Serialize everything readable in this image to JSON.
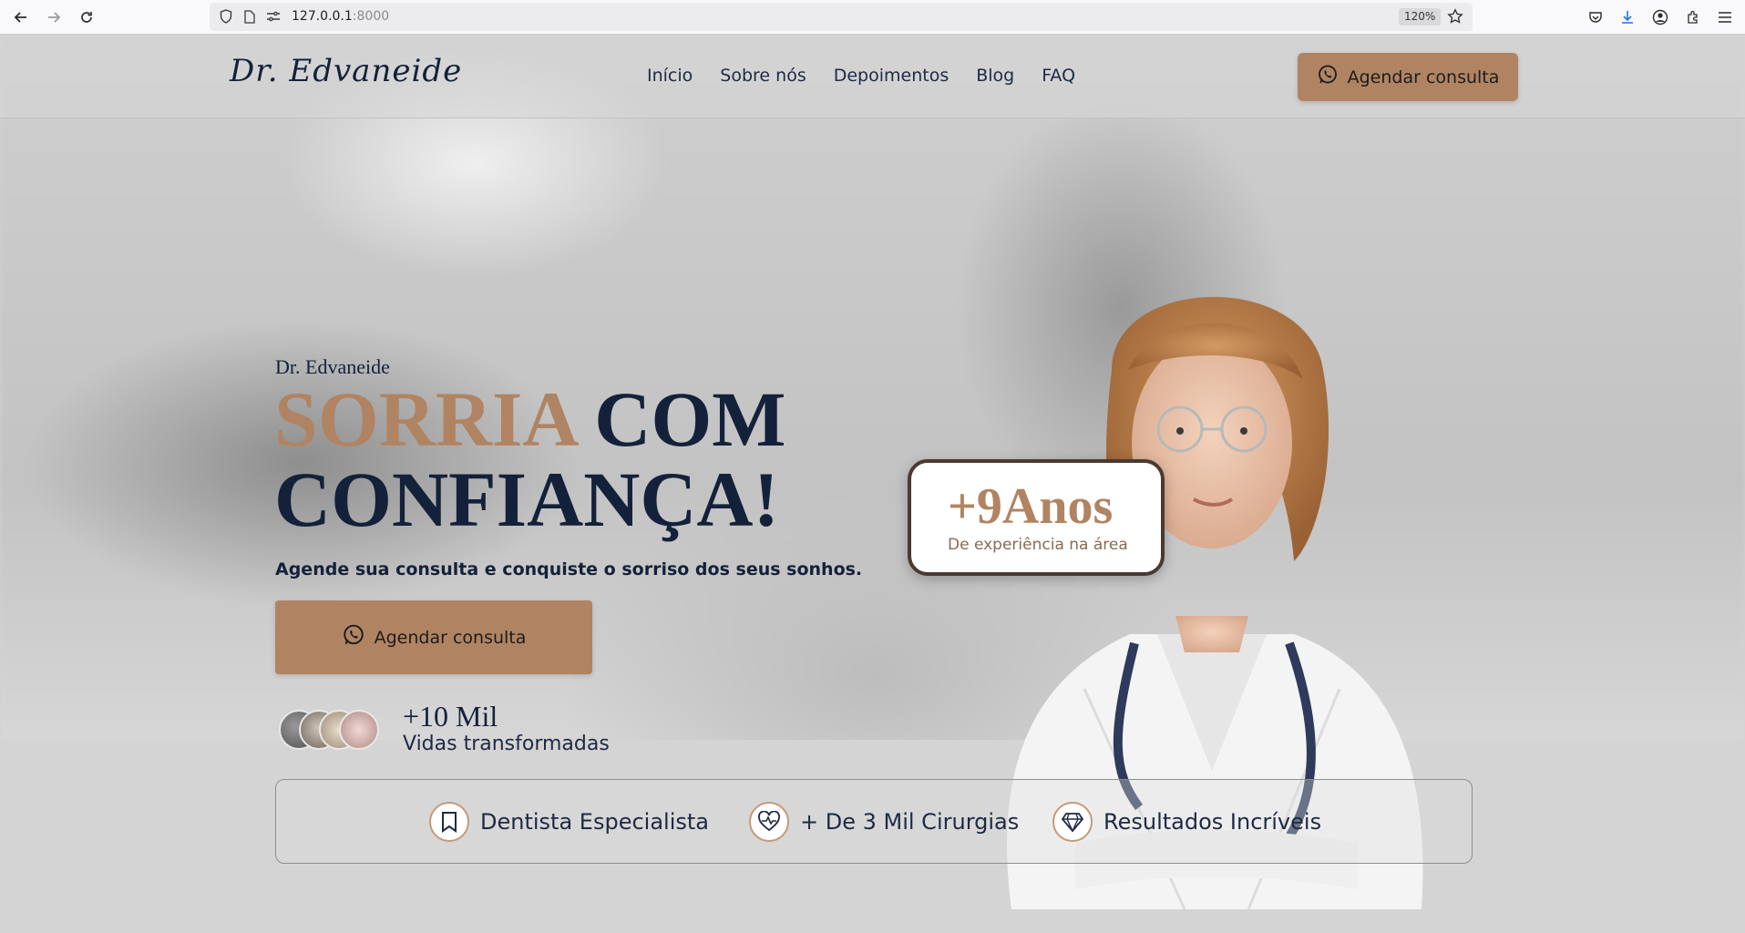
{
  "browser": {
    "url_host": "127.0.0.1",
    "url_port": ":8000",
    "zoom": "120%",
    "icons": [
      "back-icon",
      "forward-icon",
      "reload-icon",
      "shield-icon",
      "page-icon",
      "permissions-icon",
      "star-icon",
      "pocket-icon",
      "download-icon",
      "account-icon",
      "extensions-icon",
      "menu-icon"
    ]
  },
  "header": {
    "logo": "Dr. Edvaneide",
    "nav": [
      "Início",
      "Sobre nós",
      "Depoimentos",
      "Blog",
      "FAQ"
    ],
    "cta": "Agendar consulta"
  },
  "hero": {
    "eyebrow": "Dr. Edvaneide",
    "headline_accent": "SORRIA",
    "headline_rest_line1": " COM",
    "headline_line2": "CONFIANÇA!",
    "subhead": "Agende sua consulta e conquiste o sorriso dos seus sonhos.",
    "cta": "Agendar consulta",
    "stat_number": "+10 Mil",
    "stat_label": "Vidas transformadas"
  },
  "experience": {
    "number": "+9Anos",
    "label": "De experiência na área"
  },
  "features": [
    {
      "icon": "bookmark-icon",
      "label": "Dentista Especialista"
    },
    {
      "icon": "heartbeat-icon",
      "label": "+ De 3 Mil Cirurgias"
    },
    {
      "icon": "diamond-icon",
      "label": "Resultados Incríveis"
    }
  ],
  "colors": {
    "accent": "#b08462",
    "navy": "#14213a"
  }
}
